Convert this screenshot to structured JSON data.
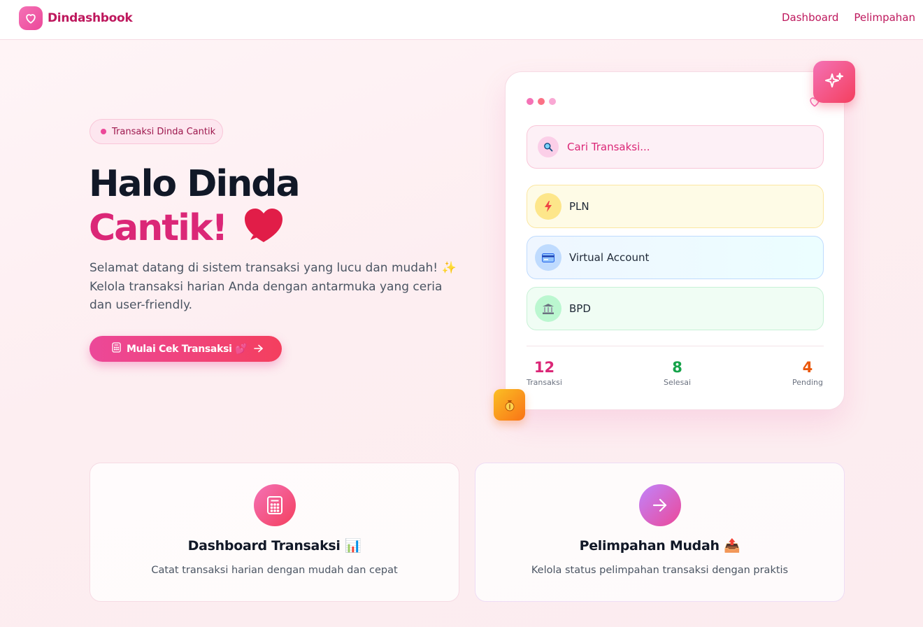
{
  "navbar": {
    "brand": "Dindashbook",
    "links": [
      "Dashboard",
      "Pelimpahan"
    ]
  },
  "hero": {
    "pill_text": "Transaksi Dinda Cantik",
    "title_line1": "Halo Dinda",
    "title_line2": "Cantik!",
    "description": "Selamat datang di sistem transaksi yang lucu dan mudah! ✨ Kelola transaksi harian Anda dengan antarmuka yang ceria dan user-friendly.",
    "cta_label": "Mulai Cek Transaksi 💕"
  },
  "preview": {
    "search_placeholder": "Cari Transaksi...",
    "items": [
      {
        "label": "PLN",
        "icon": "lightning-icon"
      },
      {
        "label": "Virtual Account",
        "icon": "credit-card-icon"
      },
      {
        "label": "BPD",
        "icon": "bank-icon"
      }
    ],
    "stats": [
      {
        "value": "12",
        "label": "Transaksi",
        "color": "#db2777"
      },
      {
        "value": "8",
        "label": "Selesai",
        "color": "#16a34a"
      },
      {
        "value": "4",
        "label": "Pending",
        "color": "#ea580c"
      }
    ]
  },
  "features": [
    {
      "title": "Dashboard Transaksi 📊",
      "desc": "Catat transaksi harian dengan mudah dan cepat",
      "icon": "calculator-icon"
    },
    {
      "title": "Pelimpahan Mudah 📤",
      "desc": "Kelola status pelimpahan transaksi dengan praktis",
      "icon": "arrow-right-icon"
    }
  ],
  "colors": {
    "accent": "#ec4899",
    "brand": "#be185d",
    "title_pink": "#db2777"
  }
}
